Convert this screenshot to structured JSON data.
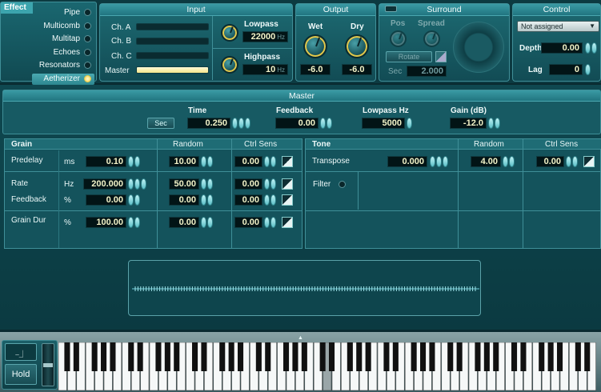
{
  "effect": {
    "title": "Effect",
    "items": [
      {
        "label": "Pipe",
        "active": false
      },
      {
        "label": "Multicomb",
        "active": false
      },
      {
        "label": "Multitap",
        "active": false
      },
      {
        "label": "Echoes",
        "active": false
      },
      {
        "label": "Resonators",
        "active": false
      },
      {
        "label": "Aetherizer",
        "active": true
      }
    ]
  },
  "input": {
    "title": "Input",
    "channels": [
      "Ch. A",
      "Ch. B",
      "Ch. C",
      "Master"
    ],
    "lowpass_label": "Lowpass",
    "lowpass_value": "22000",
    "lowpass_unit": "Hz",
    "highpass_label": "Highpass",
    "highpass_value": "10",
    "highpass_unit": "Hz"
  },
  "output": {
    "title": "Output",
    "wet_label": "Wet",
    "wet_value": "-6.0",
    "dry_label": "Dry",
    "dry_value": "-6.0"
  },
  "surround": {
    "title": "Surround",
    "pos_label": "Pos",
    "spread_label": "Spread",
    "rotate_label": "Rotate",
    "sec_label": "Sec",
    "sec_value": "2.000"
  },
  "control": {
    "title": "Control",
    "select_value": "Not assigned",
    "depth_label": "Depth",
    "depth_value": "0.00",
    "lag_label": "Lag",
    "lag_value": "0"
  },
  "master": {
    "title": "Master",
    "sec_button": "Sec",
    "time_label": "Time",
    "time_value": "0.250",
    "feedback_label": "Feedback",
    "feedback_value": "0.00",
    "lowpass_label": "Lowpass Hz",
    "lowpass_value": "5000",
    "gain_label": "Gain (dB)",
    "gain_value": "-12.0"
  },
  "grain": {
    "title": "Grain",
    "random_header": "Random",
    "ctrl_header": "Ctrl Sens",
    "rows": [
      {
        "label": "Predelay",
        "unit": "ms",
        "value": "0.10",
        "random": "10.00",
        "ctrl": "0.00"
      },
      {
        "label": "Rate",
        "unit": "Hz",
        "value": "200.000",
        "random": "50.00",
        "ctrl": "0.00"
      },
      {
        "label": "Feedback",
        "unit": "%",
        "value": "0.00",
        "random": "0.00",
        "ctrl": "0.00"
      },
      {
        "label": "Grain Dur",
        "unit": "%",
        "value": "100.00",
        "random": "0.00",
        "ctrl": "0.00"
      }
    ]
  },
  "tone": {
    "title": "Tone",
    "random_header": "Random",
    "ctrl_header": "Ctrl Sens",
    "transpose_label": "Transpose",
    "transpose_value": "0.000",
    "transpose_random": "4.00",
    "transpose_ctrl": "0.00",
    "filter_label": "Filter"
  },
  "keyboard": {
    "hold_label": "Hold"
  }
}
